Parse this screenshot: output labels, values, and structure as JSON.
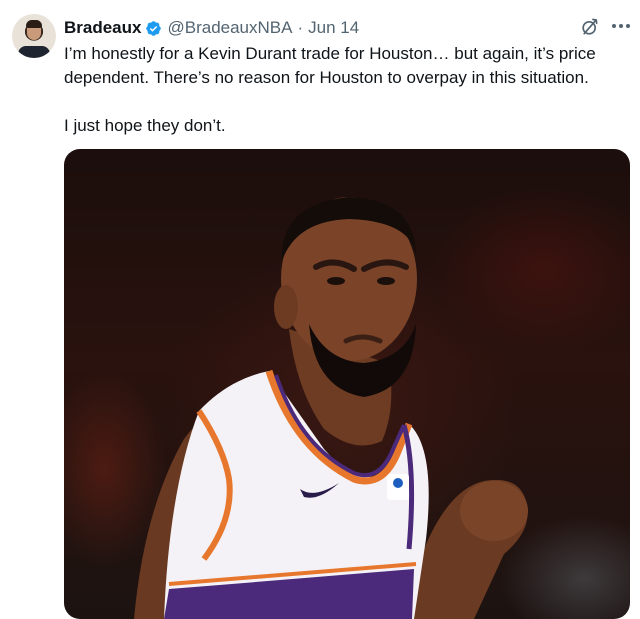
{
  "tweet": {
    "display_name": "Bradeaux",
    "handle": "@BradeauxNBA",
    "separator": "·",
    "date": "Jun 14",
    "text_line_1": "I’m honestly for a Kevin Durant trade for Houston… but again, it’s price dependent. There’s no reason for Houston to overpay in this situation.",
    "text_line_2": "I just hope they don’t."
  },
  "icons": {
    "verified": "verified-badge-icon",
    "grok": "grok-icon",
    "more": "more-options-icon"
  },
  "colors": {
    "verified_blue": "#1d9bf0",
    "text": "#0f1419",
    "secondary_text": "#536471",
    "jersey_orange": "#e8772e",
    "jersey_purple": "#4b2a7b"
  }
}
